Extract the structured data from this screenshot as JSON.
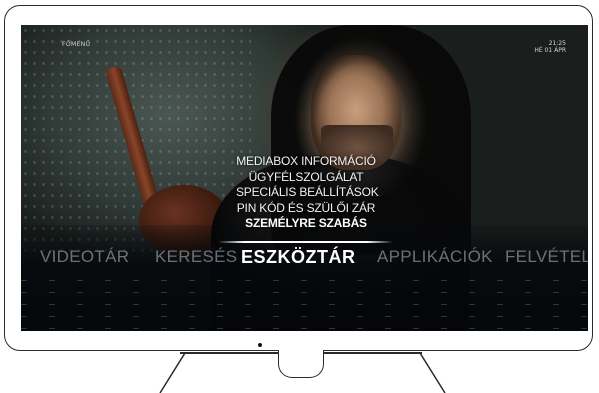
{
  "header": {
    "breadcrumb": "FŐMENÜ",
    "time": "21:25",
    "date": "HÉ 01 ÁPR"
  },
  "submenu": {
    "items": [
      {
        "label": "MEDIABOX INFORMÁCIÓ",
        "active": false
      },
      {
        "label": "ÜGYFÉLSZOLGÁLAT",
        "active": false
      },
      {
        "label": "SPECIÁLIS BEÁLLÍTÁSOK",
        "active": false
      },
      {
        "label": "PIN KÓD ÉS SZÜLŐI ZÁR",
        "active": false
      },
      {
        "label": "SZEMÉLYRE SZABÁS",
        "active": true
      }
    ]
  },
  "main_menu": {
    "items": [
      {
        "label": "VIDEOTÁR",
        "active": false
      },
      {
        "label": "KERESÉS",
        "active": false
      },
      {
        "label": "ESZKÖZTÁR",
        "active": true
      },
      {
        "label": "APPLIKÁCIÓK",
        "active": false
      },
      {
        "label": "FELVÉTELEK",
        "active": false
      }
    ]
  },
  "colors": {
    "menu_inactive": "#b9c3cd",
    "menu_active": "#ffffff",
    "frame": "#2b2b2b"
  }
}
